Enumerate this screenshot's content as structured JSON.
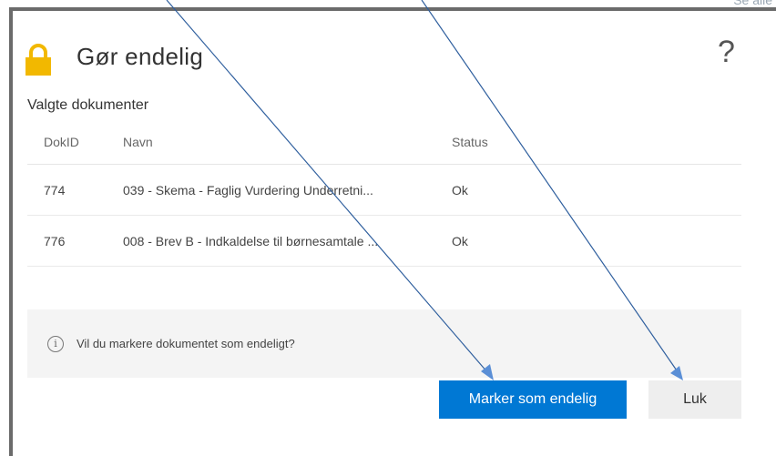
{
  "background": {
    "top_right_link": "Se alle"
  },
  "dialog": {
    "title": "Gør endelig",
    "help_icon": "?",
    "section_label": "Valgte dokumenter",
    "table": {
      "columns": [
        "DokID",
        "Navn",
        "Status"
      ],
      "rows": [
        {
          "dokid": "774",
          "navn": "039 - Skema - Faglig Vurdering Underretni...",
          "status": "Ok"
        },
        {
          "dokid": "776",
          "navn": "008 - Brev B - Indkaldelse til børnesamtale ...",
          "status": "Ok"
        }
      ]
    },
    "info": {
      "icon": "info-circle-icon",
      "glyph": "i",
      "text": "Vil du markere dokumentet som endeligt?"
    },
    "buttons": {
      "primary": "Marker som endelig",
      "secondary": "Luk"
    }
  },
  "colors": {
    "primary": "#0078d4",
    "lock": "#f2b800",
    "annotation_arrow": "#2f5f9e"
  }
}
